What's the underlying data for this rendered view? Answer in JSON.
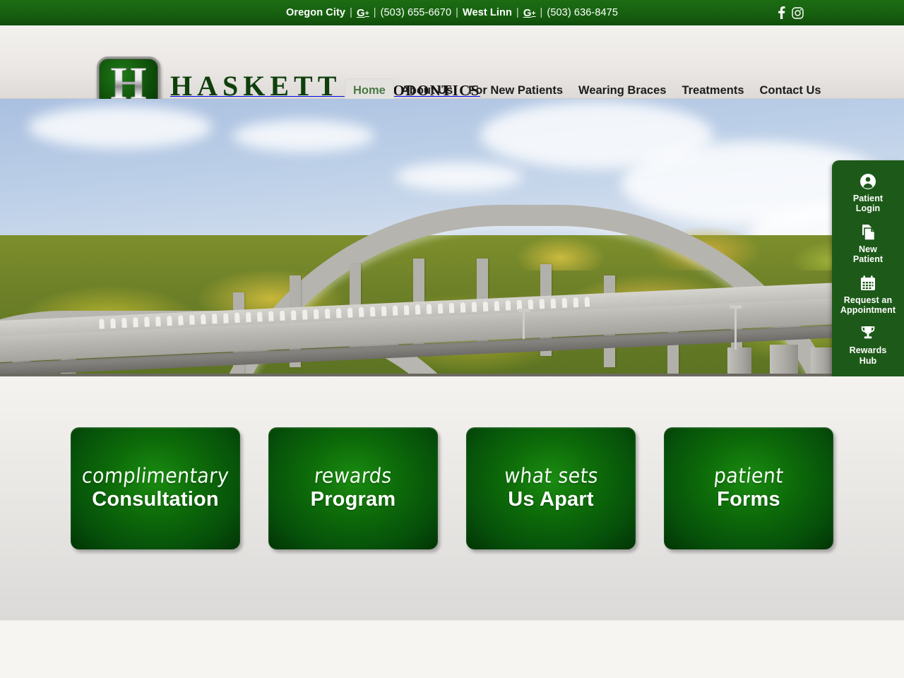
{
  "topbar": {
    "location1": "Oregon City",
    "sep": "|",
    "gplus1": "G",
    "gplus_sup": "+",
    "phone1": "(503) 655-6670",
    "location2": "West Linn",
    "gplus2": "G",
    "phone2": "(503) 636-8475",
    "social": [
      {
        "name": "facebook-icon",
        "label": "Facebook"
      },
      {
        "name": "instagram-icon",
        "label": "Instagram"
      }
    ],
    "bg_color": "#176010"
  },
  "logo": {
    "badge_letter": "H",
    "name": "HASKETT",
    "subtitle": "ORTHODONTICS",
    "green": "#0e3f0b"
  },
  "nav": {
    "items": [
      {
        "label": "Home",
        "active": true
      },
      {
        "label": "About Us",
        "active": false
      },
      {
        "label": "For New Patients",
        "active": false
      },
      {
        "label": "Wearing Braces",
        "active": false
      },
      {
        "label": "Treatments",
        "active": false
      },
      {
        "label": "Contact Us",
        "active": false
      }
    ],
    "active_color": "#4a7a45",
    "active_bg": "#e4e2de"
  },
  "hero": {
    "alt": "Oregon City Arch Bridge over autumn trees"
  },
  "quickpanel": {
    "bg_color": "#1d5a19",
    "items": [
      {
        "icon": "user-circle-icon",
        "line1": "Patient",
        "line2": "Login"
      },
      {
        "icon": "document-icon",
        "line1": "New",
        "line2": "Patient"
      },
      {
        "icon": "calendar-icon",
        "line1": "Request an",
        "line2": "Appointment"
      },
      {
        "icon": "trophy-icon",
        "line1": "Rewards",
        "line2": "Hub"
      }
    ]
  },
  "cards": [
    {
      "line1": "complimentary",
      "line2": "Consultation"
    },
    {
      "line1": "rewards",
      "line2": "Program"
    },
    {
      "line1": "what sets",
      "line2": "Us Apart"
    },
    {
      "line1": "patient",
      "line2": "Forms"
    }
  ]
}
